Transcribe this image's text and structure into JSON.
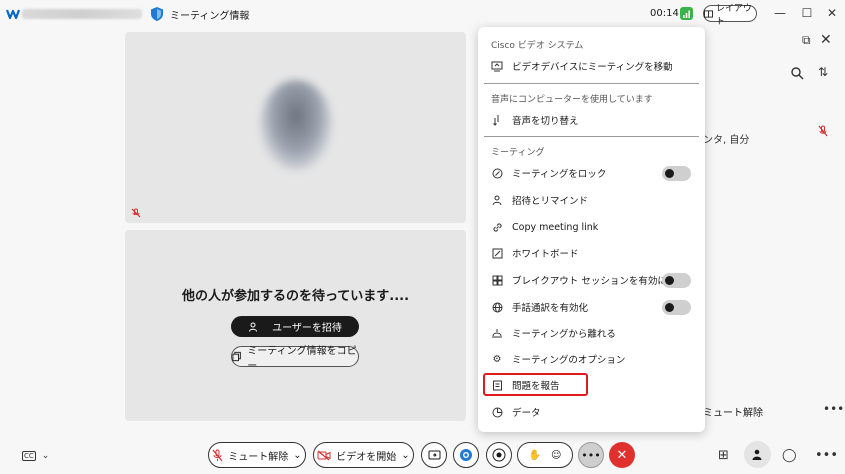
{
  "titlebar": {
    "meeting_info_label": "ミーティング情報",
    "timer": "00:14",
    "layout_label": "レイアウト"
  },
  "stage": {
    "waiting_text": "他の人が参加するのを待っています....",
    "invite_label": "ユーザーを招待",
    "copy_info_label": "ミーティング情報をコピー"
  },
  "panel": {
    "host_text": "ンタ, 自分",
    "unmute_text": "ミュート解除"
  },
  "menu": {
    "sections": {
      "cisco_video": "Cisco ビデオ システム",
      "audio": "音声にコンピューターを使用しています",
      "meeting": "ミーティング"
    },
    "items": [
      {
        "label": "ビデオデバイスにミーティングを移動",
        "icon": "screen-share-icon"
      },
      {
        "label": "音声を切り替え",
        "icon": "audio-switch-icon"
      },
      {
        "label": "ミーティングをロック",
        "icon": "lock-icon",
        "toggle": true
      },
      {
        "label": "招待とリマインド",
        "icon": "invite-person-icon"
      },
      {
        "label": "Copy meeting link",
        "icon": "link-icon"
      },
      {
        "label": "ホワイトボード",
        "icon": "whiteboard-icon"
      },
      {
        "label": "ブレイクアウト セッションを有効にする",
        "icon": "breakout-icon",
        "toggle": true
      },
      {
        "label": "手話通訳を有効化",
        "icon": "globe-icon",
        "toggle": true
      },
      {
        "label": "ミーティングから離れる",
        "icon": "leave-icon"
      },
      {
        "label": "ミーティングのオプション",
        "icon": "gear-icon"
      },
      {
        "label": "問題を報告",
        "icon": "report-icon",
        "highlighted": true
      },
      {
        "label": "データ",
        "icon": "data-icon"
      }
    ]
  },
  "bottombar": {
    "unmute_label": "ミュート解除",
    "start_video_label": "ビデオを開始"
  },
  "colors": {
    "end_call": "#e0312e",
    "highlight": "#e01b1b",
    "shield": "#1f7ad6",
    "signal": "#3ab44a"
  }
}
